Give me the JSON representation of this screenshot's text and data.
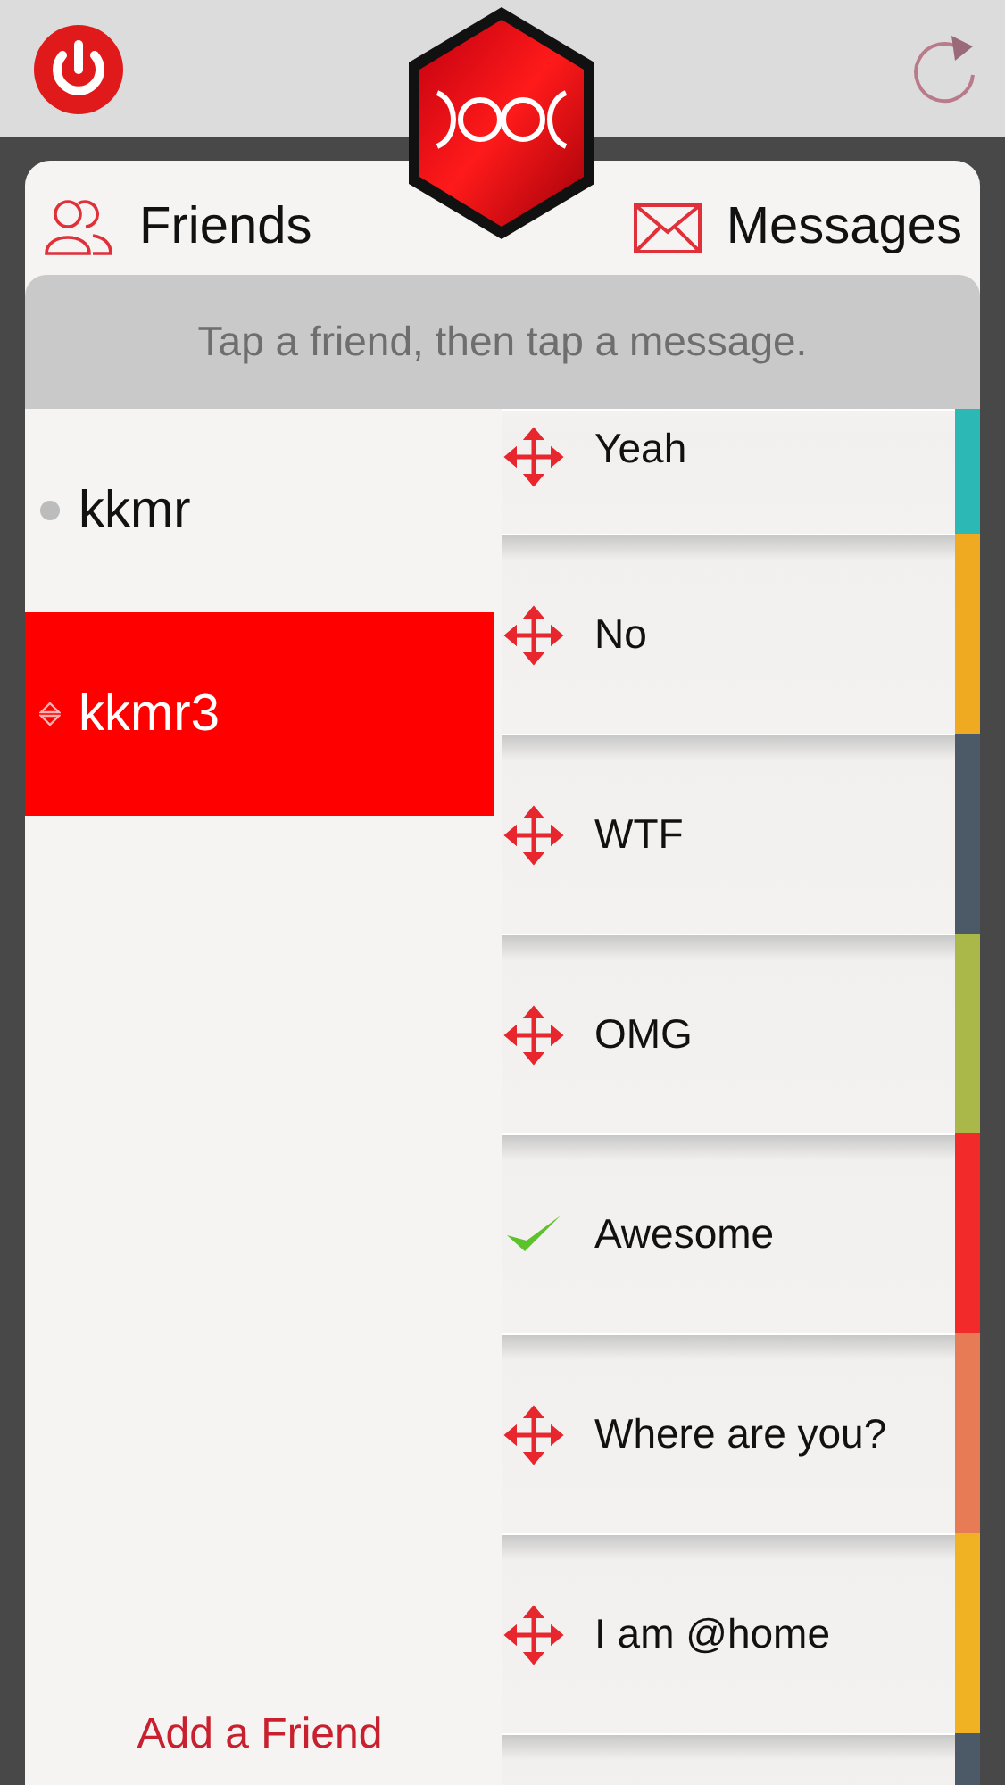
{
  "tabs": [
    {
      "label": "Friends",
      "kind": "friends"
    },
    {
      "label": "Messages",
      "kind": "messages"
    }
  ],
  "hint": "Tap a friend, then tap a message.",
  "friends": [
    {
      "name": "kkmr",
      "selected": false
    },
    {
      "name": "kkmr3",
      "selected": true
    }
  ],
  "add_friend": "Add a Friend",
  "messages": [
    {
      "label": "Yeah",
      "sent": false,
      "color": "#2cb8b4"
    },
    {
      "label": "No",
      "sent": false,
      "color": "#f0aa22"
    },
    {
      "label": "WTF",
      "sent": false,
      "color": "#4b5a66"
    },
    {
      "label": "OMG",
      "sent": false,
      "color": "#a9b848"
    },
    {
      "label": "Awesome",
      "sent": true,
      "color": "#f22a2a"
    },
    {
      "label": "Where are you?",
      "sent": false,
      "color": "#e67b55"
    },
    {
      "label": "I am @home",
      "sent": false,
      "color": "#f0b222"
    },
    {
      "color": "#4b5a66"
    }
  ]
}
